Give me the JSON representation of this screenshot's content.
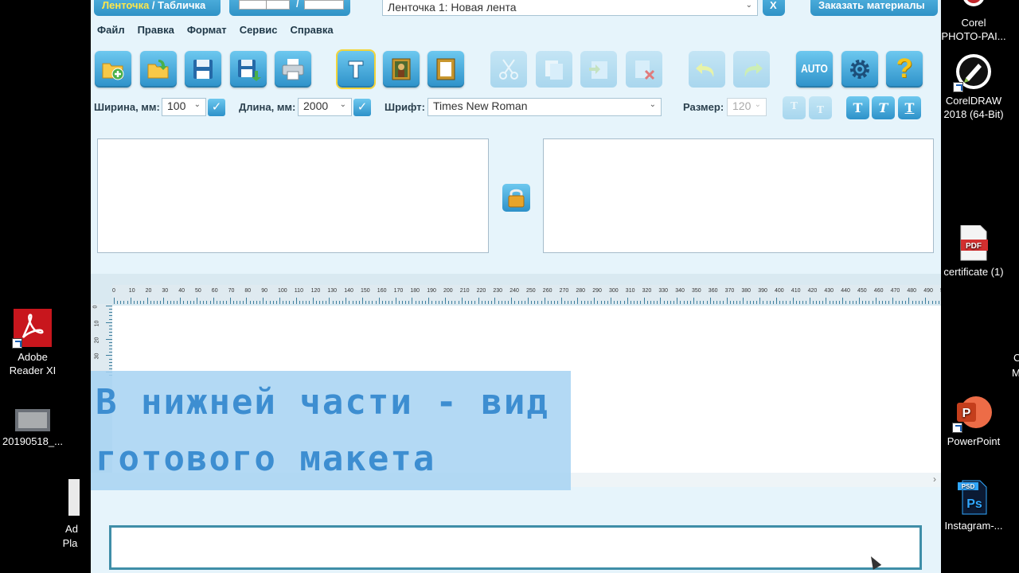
{
  "app": {
    "mode_tabs": {
      "ribbon": "Ленточка",
      "separator": " / ",
      "plate": "Табличка"
    },
    "document_select": "Ленточка 1: Новая лента",
    "close_label": "X",
    "order_button": "Заказать материалы",
    "menu": [
      "Файл",
      "Правка",
      "Формат",
      "Сервис",
      "Справка"
    ],
    "toolbar": {
      "new": "new-icon",
      "open": "open-folder-icon",
      "save": "save-icon",
      "save_as": "save-as-icon",
      "print": "printer-icon",
      "text": "text-icon",
      "image": "image-icon",
      "frame": "frame-icon",
      "cut": "scissors-icon",
      "copy": "copy-icon",
      "paste": "paste-icon",
      "delete": "delete-icon",
      "undo": "undo-icon",
      "redo": "redo-icon",
      "auto": "AUTO",
      "settings": "gear-icon",
      "help": "?"
    },
    "params": {
      "width_label": "Ширина, мм:",
      "width_value": "100",
      "length_label": "Длина, мм:",
      "length_value": "2000",
      "font_label": "Шрифт:",
      "font_value": "Times New Roman",
      "size_label": "Размер:",
      "size_value": "120",
      "check": "✓",
      "style_buttons": [
        "T",
        "T",
        "T",
        "T",
        "T"
      ]
    },
    "ruler_top": [
      "0",
      "10",
      "20",
      "30",
      "40",
      "50",
      "60",
      "70",
      "80",
      "90",
      "100",
      "110",
      "120",
      "130",
      "140",
      "150",
      "160",
      "170",
      "180",
      "190",
      "200",
      "210",
      "220",
      "230",
      "240",
      "250",
      "260",
      "270",
      "280",
      "290",
      "300",
      "310",
      "320",
      "330",
      "340",
      "350",
      "360",
      "370",
      "380",
      "390",
      "400",
      "410",
      "420",
      "430",
      "440",
      "450",
      "460",
      "470",
      "480",
      "490",
      "5"
    ],
    "ruler_left": [
      "0",
      "10",
      "20",
      "30"
    ],
    "caption_lines": [
      "В нижней части - вид",
      "готового макета"
    ]
  },
  "desktop": {
    "right": [
      {
        "label_1": "Corel",
        "label_2": "PHOTO-PAI...",
        "icon": "corel-photopaint-icon"
      },
      {
        "label_1": "CorelDRAW",
        "label_2": "2018 (64-Bit)",
        "icon": "coreldraw-icon"
      },
      {
        "label_1": "certificate (1)",
        "label_2": "",
        "icon": "pdf-file-icon",
        "badge": "PDF"
      },
      {
        "label_1": "PowerPoint",
        "label_2": "",
        "icon": "powerpoint-icon",
        "badge": "P"
      },
      {
        "label_1": "Instagram-...",
        "label_2": "",
        "icon": "photoshop-file-icon",
        "badge": "Ps",
        "sub": "PSD"
      }
    ],
    "left": [
      {
        "label_1": "Adobe",
        "label_2": "Reader XI",
        "icon": "adobe-reader-icon"
      },
      {
        "label_1": "20190518_...",
        "label_2": "",
        "icon": "image-file-icon"
      },
      {
        "label_1": "Ad",
        "label_2": "Pla",
        "icon": "adobe-player-icon"
      }
    ],
    "right_edge": [
      "C",
      "M"
    ]
  }
}
